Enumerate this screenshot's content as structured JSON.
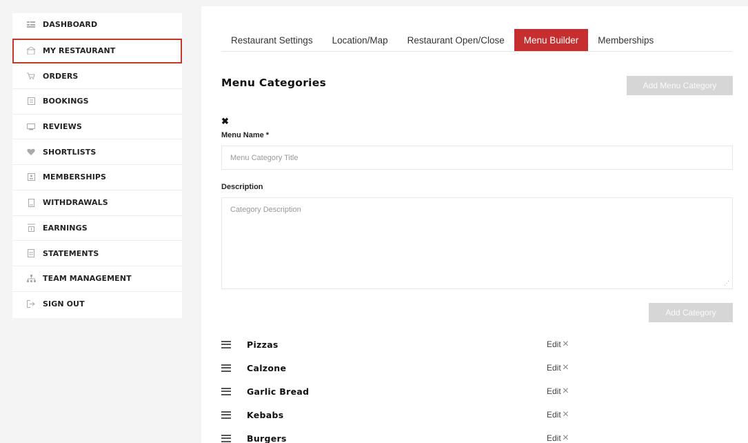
{
  "sidebar": {
    "items": [
      {
        "label": "DASHBOARD",
        "icon": "dashboard-icon"
      },
      {
        "label": "MY RESTAURANT",
        "icon": "restaurant-icon"
      },
      {
        "label": "ORDERS",
        "icon": "cart-icon"
      },
      {
        "label": "BOOKINGS",
        "icon": "list-icon"
      },
      {
        "label": "REVIEWS",
        "icon": "comment-icon"
      },
      {
        "label": "SHORTLISTS",
        "icon": "heart-icon"
      },
      {
        "label": "MEMBERSHIPS",
        "icon": "id-card-icon"
      },
      {
        "label": "WITHDRAWALS",
        "icon": "receipt-icon"
      },
      {
        "label": "EARNINGS",
        "icon": "wallet-icon"
      },
      {
        "label": "STATEMENTS",
        "icon": "document-icon"
      },
      {
        "label": "TEAM MANAGEMENT",
        "icon": "sitemap-icon"
      },
      {
        "label": "SIGN OUT",
        "icon": "sign-out-icon"
      }
    ]
  },
  "tabs": [
    {
      "label": "Restaurant Settings"
    },
    {
      "label": "Location/Map"
    },
    {
      "label": "Restaurant Open/Close"
    },
    {
      "label": "Menu Builder"
    },
    {
      "label": "Memberships"
    }
  ],
  "main": {
    "title": "Menu Categories",
    "add_menu_category_label": "Add Menu Category",
    "close_glyph": "✖",
    "menu_name_label": "Menu Name *",
    "menu_name_placeholder": "Menu Category Title",
    "description_label": "Description",
    "description_placeholder": "Category Description",
    "add_category_label": "Add Category"
  },
  "categories": [
    {
      "name": "Pizzas",
      "edit": "Edit"
    },
    {
      "name": "Calzone",
      "edit": "Edit"
    },
    {
      "name": "Garlic Bread",
      "edit": "Edit"
    },
    {
      "name": "Kebabs",
      "edit": "Edit"
    },
    {
      "name": "Burgers",
      "edit": "Edit"
    }
  ],
  "colors": {
    "accent": "#c62f2f",
    "disabled_button": "#d6d6d6"
  }
}
